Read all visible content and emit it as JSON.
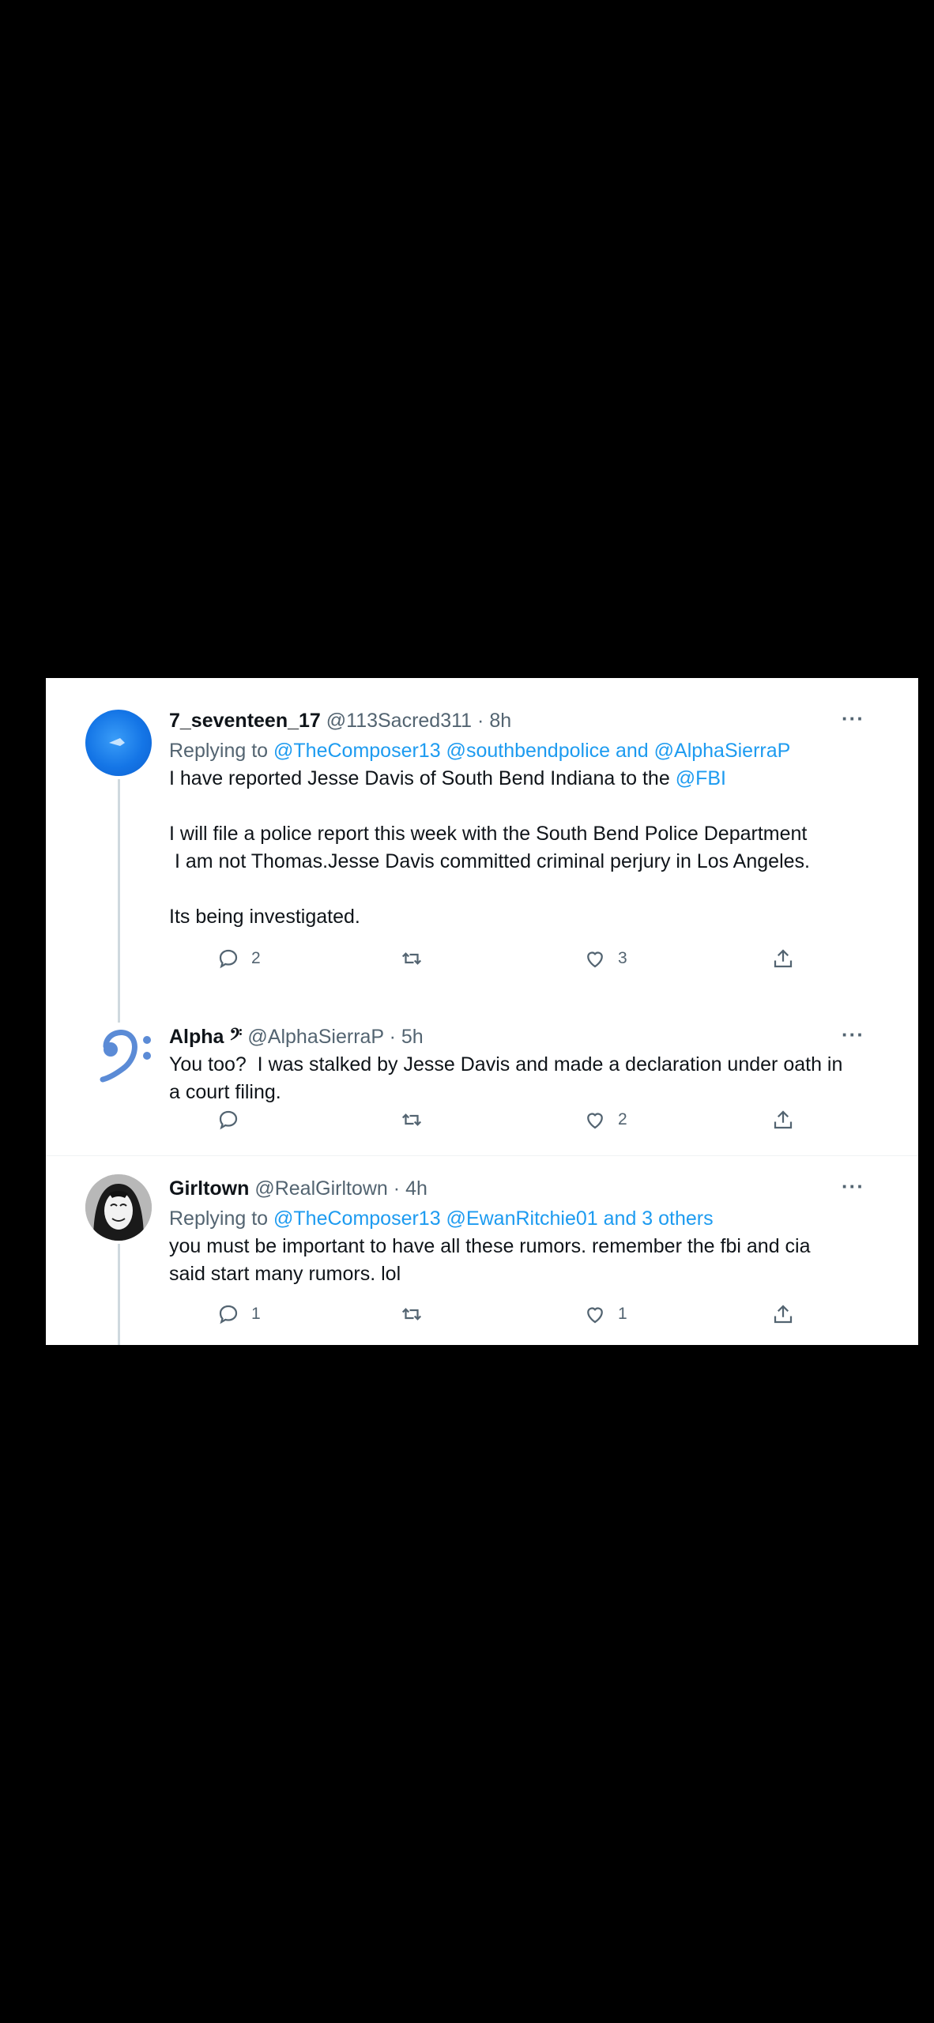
{
  "tweets": [
    {
      "display_name": "7_seventeen_17",
      "handle": "@113Sacred311",
      "time": "8h",
      "replying_prefix": "Replying to",
      "replying_links": "@TheComposer13 @southbendpolice and @AlphaSierraP",
      "line1_text": "I have reported Jesse Davis of South Bend Indiana to the",
      "line1_link": "@FBI",
      "line2": "I will file a police report this week with the South Bend Police Department",
      "line3": " I am not Thomas.Jesse Davis committed criminal perjury in Los Angeles.",
      "line4": "Its being investigated.",
      "replies": "2",
      "retweets": "",
      "likes": "3",
      "avatar_icon": "blue-circle-avatar-icon"
    },
    {
      "display_name": "Alpha 𝄢",
      "handle": "@AlphaSierraP",
      "time": "5h",
      "line1": "You too?  I was stalked by Jesse Davis and made a declaration under oath in",
      "line2": "a court filing.",
      "replies": "",
      "retweets": "",
      "likes": "2",
      "avatar_icon": "bass-clef-avatar-icon"
    },
    {
      "display_name": "Girltown",
      "handle": "@RealGirltown",
      "time": "4h",
      "replying_prefix": "Replying to",
      "replying_links": "@TheComposer13 @EwanRitchie01 and 3 others",
      "line1": "you must be important to have all these rumors. remember the fbi and cia",
      "line2": "said start many rumors. lol",
      "replies": "1",
      "retweets": "",
      "likes": "1",
      "avatar_icon": "mask-avatar-icon"
    }
  ],
  "ui": {
    "separator": "·",
    "more": "···"
  },
  "colors": {
    "link": "#1d9bf0",
    "secondary": "#536471",
    "text": "#0f1419"
  }
}
